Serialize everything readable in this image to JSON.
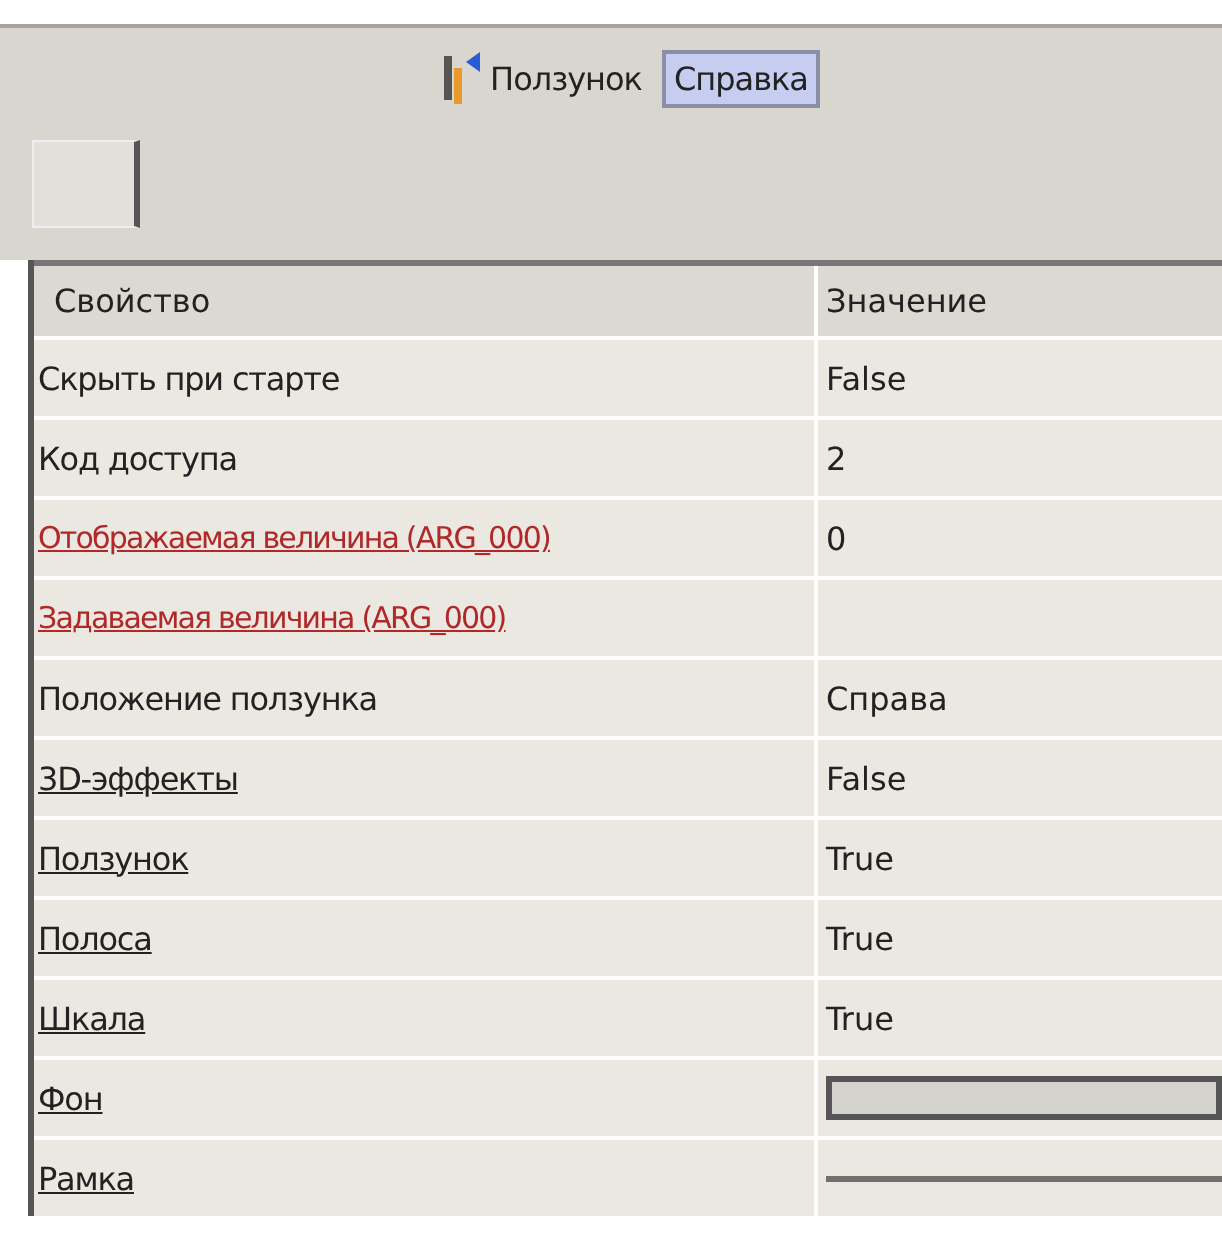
{
  "header": {
    "title": "Ползунок",
    "help_button": {
      "label": "Справка",
      "selected": true
    }
  },
  "table": {
    "columns": [
      "Свойство",
      "Значение"
    ],
    "rows": [
      {
        "name": "Скрыть при старте",
        "link": false,
        "highlighted": false,
        "kind": "text",
        "value": "False"
      },
      {
        "name": "Код доступа",
        "link": false,
        "highlighted": false,
        "kind": "text",
        "value": "2"
      },
      {
        "name": "Отображаемая величина (ARG_000)",
        "link": true,
        "highlighted": true,
        "kind": "text",
        "value": "0"
      },
      {
        "name": "Задаваемая величина (ARG_000)",
        "link": true,
        "highlighted": true,
        "kind": "empty"
      },
      {
        "name": "Положение ползунка",
        "link": false,
        "highlighted": false,
        "kind": "text",
        "value": "Справа"
      },
      {
        "name": "3D-эффекты",
        "link": true,
        "highlighted": false,
        "kind": "text",
        "value": "False"
      },
      {
        "name": "Ползунок",
        "link": true,
        "highlighted": false,
        "kind": "text",
        "value": "True"
      },
      {
        "name": "Полоса",
        "link": true,
        "highlighted": false,
        "kind": "text",
        "value": "True"
      },
      {
        "name": "Шкала",
        "link": true,
        "highlighted": false,
        "kind": "text",
        "value": "True"
      },
      {
        "name": "Фон",
        "link": true,
        "highlighted": false,
        "kind": "swatch",
        "color": "#d4d2cc"
      },
      {
        "name": "Рамка",
        "link": true,
        "highlighted": false,
        "kind": "line",
        "color": "#707070"
      }
    ]
  }
}
